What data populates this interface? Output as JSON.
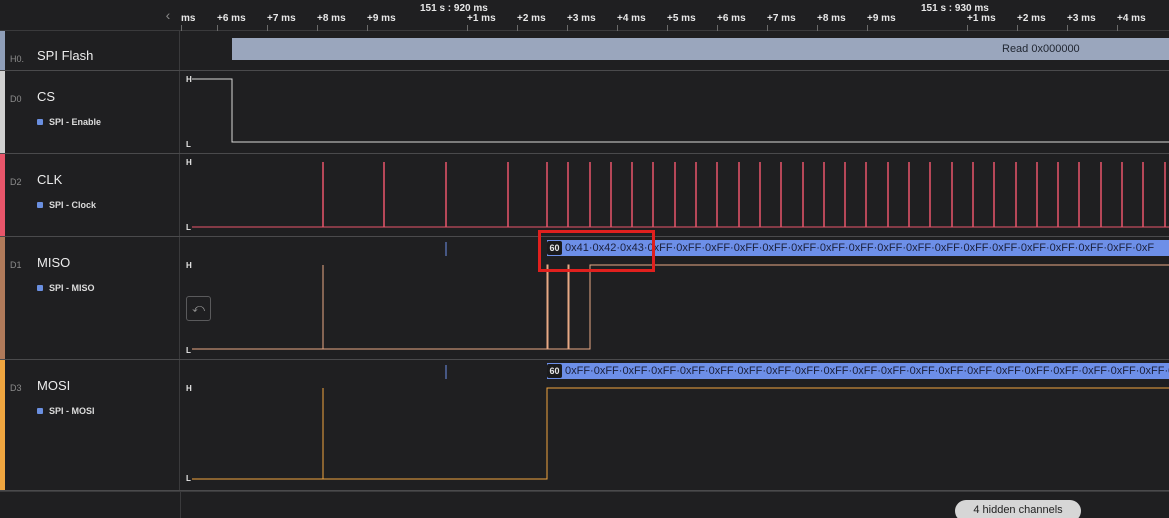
{
  "timeline": {
    "collapse_icon": "chevron-left-icon",
    "anchor_1": "151 s : 920 ms",
    "anchor_2": "151 s : 930 ms",
    "ticks": [
      "ms",
      "+6 ms",
      "+7 ms",
      "+8 ms",
      "+9 ms",
      "+1 ms",
      "+2 ms",
      "+3 ms",
      "+4 ms",
      "+5 ms",
      "+6 ms",
      "+7 ms",
      "+8 ms",
      "+9 ms",
      "+1 ms",
      "+2 ms",
      "+3 ms",
      "+4 ms"
    ]
  },
  "channels": [
    {
      "id": "H0.",
      "name": "SPI Flash",
      "color": "#8f9eb8"
    },
    {
      "id": "D0",
      "name": "CS",
      "analyzer": "SPI - Enable",
      "color": "#d0d0d0"
    },
    {
      "id": "D2",
      "name": "CLK",
      "analyzer": "SPI - Clock",
      "color": "#e8556a"
    },
    {
      "id": "D1",
      "name": "MISO",
      "analyzer": "SPI - MISO",
      "color": "#b07a5a"
    },
    {
      "id": "D3",
      "name": "MOSI",
      "analyzer": "SPI - MOSI",
      "color": "#f0a640"
    }
  ],
  "levels": {
    "high": "H",
    "low": "L"
  },
  "flash": {
    "read_label": "Read 0x000000"
  },
  "miso": {
    "start_badge": "60",
    "bytes": "0x41·0x42·0x43·0xFF·0xFF·0xFF·0xFF·0xFF·0xFF·0xFF·0xFF·0xFF·0xFF·0xFF·0xFF·0xFF·0xFF·0xFF·0xFF·0xFF·0xF"
  },
  "mosi": {
    "start_badge": "60",
    "bytes": "0xFF·0xFF·0xFF·0xFF·0xFF·0xFF·0xFF·0xFF·0xFF·0xFF·0xFF·0xFF·0xFF·0xFF·0xFF·0xFF·0xFF·0xFF·0xFF·0xFF·0xFF·0xF"
  },
  "reset_icon": "reset-zoom-icon",
  "hidden_channels": "4 hidden channels",
  "colors": {
    "clk_wave": "#e8556a",
    "miso_wave": "#e8a985",
    "mosi_wave": "#f0a640",
    "cs_wave": "#d8d8d8",
    "pill": "#6d8fe8",
    "highlight": "#e0201e"
  }
}
